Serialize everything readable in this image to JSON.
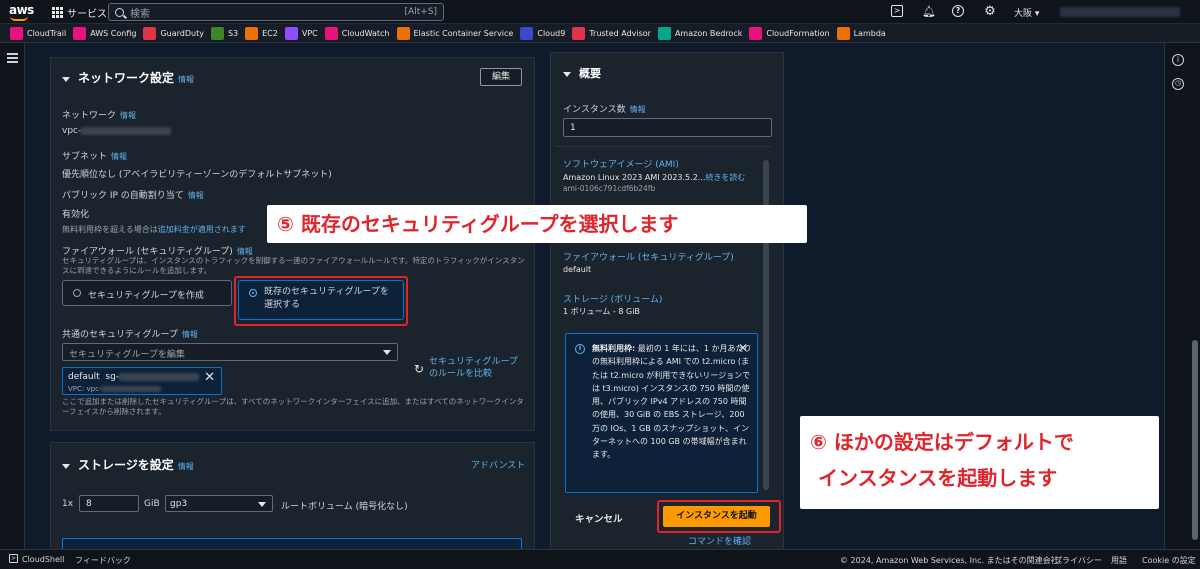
{
  "topbar": {
    "logo": "aws",
    "services": "サービス",
    "search_placeholder": "検索",
    "search_shortcut": "[Alt+S]",
    "region": "大阪 ▾"
  },
  "favorites": [
    {
      "label": "CloudTrail",
      "color": "#e7157b"
    },
    {
      "label": "AWS Config",
      "color": "#e7157b"
    },
    {
      "label": "GuardDuty",
      "color": "#dd344c"
    },
    {
      "label": "S3",
      "color": "#3f8624"
    },
    {
      "label": "EC2",
      "color": "#ed7100"
    },
    {
      "label": "VPC",
      "color": "#8c4fff"
    },
    {
      "label": "CloudWatch",
      "color": "#e7157b"
    },
    {
      "label": "Elastic Container Service",
      "color": "#ed7100"
    },
    {
      "label": "Cloud9",
      "color": "#3b48cc"
    },
    {
      "label": "Trusted Advisor",
      "color": "#dd344c"
    },
    {
      "label": "Amazon Bedrock",
      "color": "#01a88d"
    },
    {
      "label": "CloudFormation",
      "color": "#e7157b"
    },
    {
      "label": "Lambda",
      "color": "#ed7100"
    }
  ],
  "network": {
    "title": "ネットワーク設定",
    "info": "情報",
    "edit": "編集",
    "network_label": "ネットワーク",
    "network_info": "情報",
    "vpc_prefix": "vpc-",
    "subnet_label": "サブネット",
    "subnet_info": "情報",
    "subnet_value": "優先順位なし (アベイラビリティーゾーンのデフォルトサブネット)",
    "public_ip_label": "パブリック IP の自動割り当て",
    "public_ip_info": "情報",
    "public_ip_value": "有効化",
    "free_tier_note": "無料利用枠を超える場合は",
    "free_tier_link": "追加料金が適用されます",
    "firewall_label": "ファイアウォール (セキュリティグループ)",
    "firewall_info": "情報",
    "firewall_desc": "セキュリティグループは、インスタンスのトラフィックを制御する一連のファイアウォールルールです。特定のトラフィックがインスタンスに到達できるようにルールを追加します。",
    "radio_create": "セキュリティグループを作成",
    "radio_existing": "既存のセキュリティグループを選択する",
    "common_sg_label": "共通のセキュリティグループ",
    "common_sg_info": "情報",
    "sg_select_placeholder": "セキュリティグループを編集",
    "sg_compare_link": "セキュリティグループのルールを比較",
    "sg_token_name": "default",
    "sg_token_id_prefix": "sg-",
    "sg_token_vpc": "VPC: vpc-",
    "sg_note": "ここで追加または削除したセキュリティグループは、すべてのネットワークインターフェイスに追加、またはすべてのネットワークインターフェイスから削除されます。"
  },
  "storage": {
    "title": "ストレージを設定",
    "info": "情報",
    "advanced": "アドバンスト",
    "count_prefix": "1x",
    "size": "8",
    "unit": "GiB",
    "type": "gp3",
    "root_label": "ルートボリューム (暗号化なし)"
  },
  "summary": {
    "title": "概要",
    "instance_count_label": "インスタンス数",
    "instance_count_info": "情報",
    "instance_count_value": "1",
    "software_image_label": "ソフトウェアイメージ (AMI)",
    "software_image_value": "Amazon Linux 2023 AMI 2023.5.2...",
    "software_image_more": "続きを読む",
    "ami_id": "ami-0106c791cdf6b24fb",
    "firewall_label": "ファイアウォール (セキュリティグループ)",
    "firewall_value": "default",
    "storage_label": "ストレージ (ボリューム)",
    "storage_value": "1 ボリューム - 8 GiB",
    "free_tier_bold": "無料利用枠:",
    "free_tier_text": " 最初の 1 年には、1 か月あたりの無料利用枠による AMI での t2.micro (または t2.micro が利用できないリージョンでは t3.micro) インスタンスの 750 時間の使用、パブリック IPv4 アドレスの 750 時間の使用、30 GiB の EBS ストレージ、200 万の IOs、1 GB のスナップショット、インターネットへの 100 GB の帯域幅が含まれます。",
    "cancel": "キャンセル",
    "launch": "インスタンスを起動",
    "command_link": "コマンドを確認"
  },
  "callouts": {
    "step5": "⑤ 既存のセキュリティグループを選択します",
    "step6_line1": "⑥ ほかの設定はデフォルトで",
    "step6_line2": "インスタンスを起動します"
  },
  "footer": {
    "cloudshell": "CloudShell",
    "feedback": "フィードバック",
    "copyright": "© 2024, Amazon Web Services, Inc. またはその関連会社。",
    "privacy": "プライバシー",
    "terms": "用語",
    "cookie": "Cookie の設定"
  }
}
